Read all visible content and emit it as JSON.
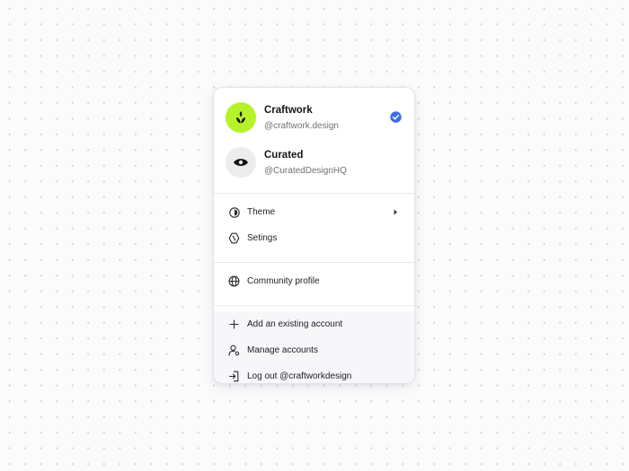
{
  "accounts": [
    {
      "name": "Craftwork",
      "handle": "@craftwork.design",
      "avatar_icon": "leaf-sprout-icon",
      "avatar_color": "#b6f22a",
      "selected": true
    },
    {
      "name": "Curated",
      "handle": "@CuratedDesignHQ",
      "avatar_icon": "eye-icon",
      "avatar_color": "#ececef",
      "selected": false
    }
  ],
  "menu": {
    "theme_label": "Theme",
    "settings_label": "Setings",
    "community_label": "Community profile",
    "add_account_label": "Add an existing account",
    "manage_accounts_label": "Manage accounts",
    "logout_label": "Log out @craftworkdesign"
  },
  "icons": {
    "theme": "half-circle-contrast-icon",
    "settings": "hexagon-gear-icon",
    "community": "globe-icon",
    "add": "plus-icon",
    "manage": "user-cog-icon",
    "logout": "logout-icon",
    "submenu": "chevron-right-icon",
    "selected": "check-circle-icon"
  },
  "colors": {
    "accent_check": "#3d6be0",
    "craftwork_avatar": "#b6f22a",
    "curated_avatar": "#ececef"
  }
}
